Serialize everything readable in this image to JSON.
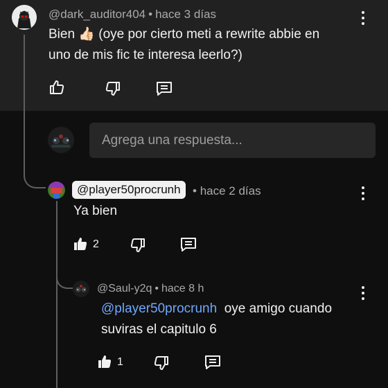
{
  "comment": {
    "handle": "@dark_auditor404",
    "time": "hace 3 días",
    "text_line1": "Bien 👍🏻 (oye por cierto meti a rewrite abbie en",
    "text_line2": "uno de mis fic te interesa leerlo?)"
  },
  "reply_input": {
    "placeholder": "Agrega una respuesta..."
  },
  "replies": [
    {
      "handle": "@player50procrunh",
      "time": "hace 2 días",
      "text": "Ya bien",
      "likes": "2"
    },
    {
      "handle": "@Saul-y2q",
      "time": "hace 8 h",
      "mention": "@player50procrunh",
      "text_line1": "oye amigo cuando",
      "text_line2": "suviras el capitulo 6",
      "likes": "1"
    }
  ],
  "separator": "•",
  "colors": {
    "background": "#0f0f0f",
    "panel": "#212121",
    "mention": "#6fa8ff",
    "input": "#272727"
  },
  "icons": [
    "like-icon",
    "dislike-icon",
    "reply-icon",
    "more-vert-icon"
  ]
}
